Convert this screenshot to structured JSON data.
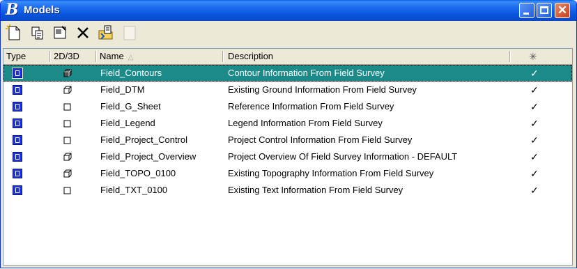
{
  "window": {
    "title": "Models"
  },
  "toolbar": {
    "buttons": [
      {
        "name": "new-model",
        "icon": "new-document-icon"
      },
      {
        "name": "copy-model",
        "icon": "copy-icon"
      },
      {
        "name": "properties",
        "icon": "properties-icon"
      },
      {
        "name": "delete",
        "icon": "delete-x-icon"
      },
      {
        "name": "import",
        "icon": "import-folder-icon"
      },
      {
        "name": "disabled-action",
        "icon": "blank-document-icon"
      }
    ]
  },
  "table": {
    "columns": [
      "Type",
      "2D/3D",
      "Name",
      "Description",
      "✳"
    ],
    "sorted_column": "Name",
    "rows": [
      {
        "dim": "3d-shaded",
        "name": "Field_Contours",
        "description": "Contour Information From Field Survey",
        "check": "✓",
        "selected": true
      },
      {
        "dim": "3d",
        "name": "Field_DTM",
        "description": "Existing Ground Information From Field Survey",
        "check": "✓"
      },
      {
        "dim": "2d",
        "name": "Field_G_Sheet",
        "description": "Reference Information From Field Survey",
        "check": "✓"
      },
      {
        "dim": "2d",
        "name": "Field_Legend",
        "description": "Legend Information From Field Survey",
        "check": "✓"
      },
      {
        "dim": "2d",
        "name": "Field_Project_Control",
        "description": "Project Control Information From Field Survey",
        "check": "✓"
      },
      {
        "dim": "3d",
        "name": "Field_Project_Overview",
        "description": "Project Overview Of Field Survey Information - DEFAULT",
        "check": "✓"
      },
      {
        "dim": "3d",
        "name": "Field_TOPO_0100",
        "description": "Existing Topography Information From Field Survey",
        "check": "✓"
      },
      {
        "dim": "2d",
        "name": "Field_TXT_0100",
        "description": "Existing Text Information From Field Survey",
        "check": "✓"
      }
    ]
  },
  "colors": {
    "selection": "#1d8a8a",
    "title_bar": "#0a5fe8",
    "type_icon": "#1f34d8"
  }
}
